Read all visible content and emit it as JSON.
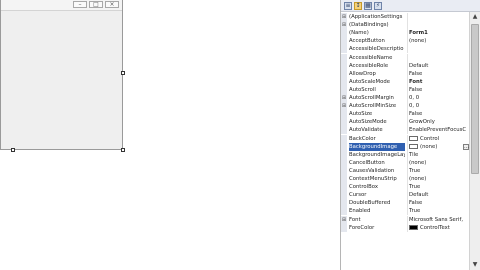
{
  "designer": {
    "caption_buttons": [
      {
        "name": "minimize",
        "glyph": "–"
      },
      {
        "name": "maximize",
        "glyph": "□"
      },
      {
        "name": "close",
        "glyph": "×"
      }
    ]
  },
  "properties": {
    "toolbar": [
      {
        "name": "categorized",
        "glyph": "≡",
        "on": false
      },
      {
        "name": "alphabetical",
        "glyph": "↕",
        "on": true
      },
      {
        "name": "properties",
        "glyph": "▦",
        "on": false
      },
      {
        "name": "events",
        "glyph": "⚡",
        "on": false
      }
    ],
    "rows": [
      {
        "kind": "cat",
        "name": "(ApplicationSettings",
        "value": ""
      },
      {
        "kind": "cat",
        "name": "(DataBindings)",
        "value": ""
      },
      {
        "kind": "prop",
        "name": "(Name)",
        "value": "Form1",
        "bold": true
      },
      {
        "kind": "prop",
        "name": "AcceptButton",
        "value": "(none)"
      },
      {
        "kind": "prop",
        "name": "AccessibleDescriptio",
        "value": ""
      },
      {
        "kind": "prop",
        "name": "AccessibleName",
        "value": ""
      },
      {
        "kind": "prop",
        "name": "AccessibleRole",
        "value": "Default"
      },
      {
        "kind": "prop",
        "name": "AllowDrop",
        "value": "False"
      },
      {
        "kind": "prop",
        "name": "AutoScaleMode",
        "value": "Font",
        "bold": true
      },
      {
        "kind": "prop",
        "name": "AutoScroll",
        "value": "False"
      },
      {
        "kind": "cat",
        "name": "AutoScrollMargin",
        "value": "0, 0"
      },
      {
        "kind": "cat",
        "name": "AutoScrollMinSize",
        "value": "0, 0"
      },
      {
        "kind": "prop",
        "name": "AutoSize",
        "value": "False"
      },
      {
        "kind": "prop",
        "name": "AutoSizeMode",
        "value": "GrowOnly"
      },
      {
        "kind": "prop",
        "name": "AutoValidate",
        "value": "EnablePreventFocusC"
      },
      {
        "kind": "prop",
        "name": "BackColor",
        "value": "Control",
        "swatch": "#ffffff"
      },
      {
        "kind": "prop",
        "name": "BackgroundImage",
        "value": "(none)",
        "swatch": "#ffffff",
        "selected": true,
        "ellipsis": true
      },
      {
        "kind": "prop",
        "name": "BackgroundImageLay",
        "value": "Tile"
      },
      {
        "kind": "prop",
        "name": "CancelButton",
        "value": "(none)"
      },
      {
        "kind": "prop",
        "name": "CausesValidation",
        "value": "True"
      },
      {
        "kind": "prop",
        "name": "ContextMenuStrip",
        "value": "(none)"
      },
      {
        "kind": "prop",
        "name": "ControlBox",
        "value": "True"
      },
      {
        "kind": "prop",
        "name": "Cursor",
        "value": "Default"
      },
      {
        "kind": "prop",
        "name": "DoubleBuffered",
        "value": "False"
      },
      {
        "kind": "prop",
        "name": "Enabled",
        "value": "True"
      },
      {
        "kind": "cat",
        "name": "Font",
        "value": "Microsoft Sans Serif,"
      },
      {
        "kind": "prop",
        "name": "ForeColor",
        "value": "ControlText",
        "swatch": "#000000"
      }
    ]
  },
  "scrollbar": {
    "up_glyph": "▲",
    "down_glyph": "▼"
  }
}
